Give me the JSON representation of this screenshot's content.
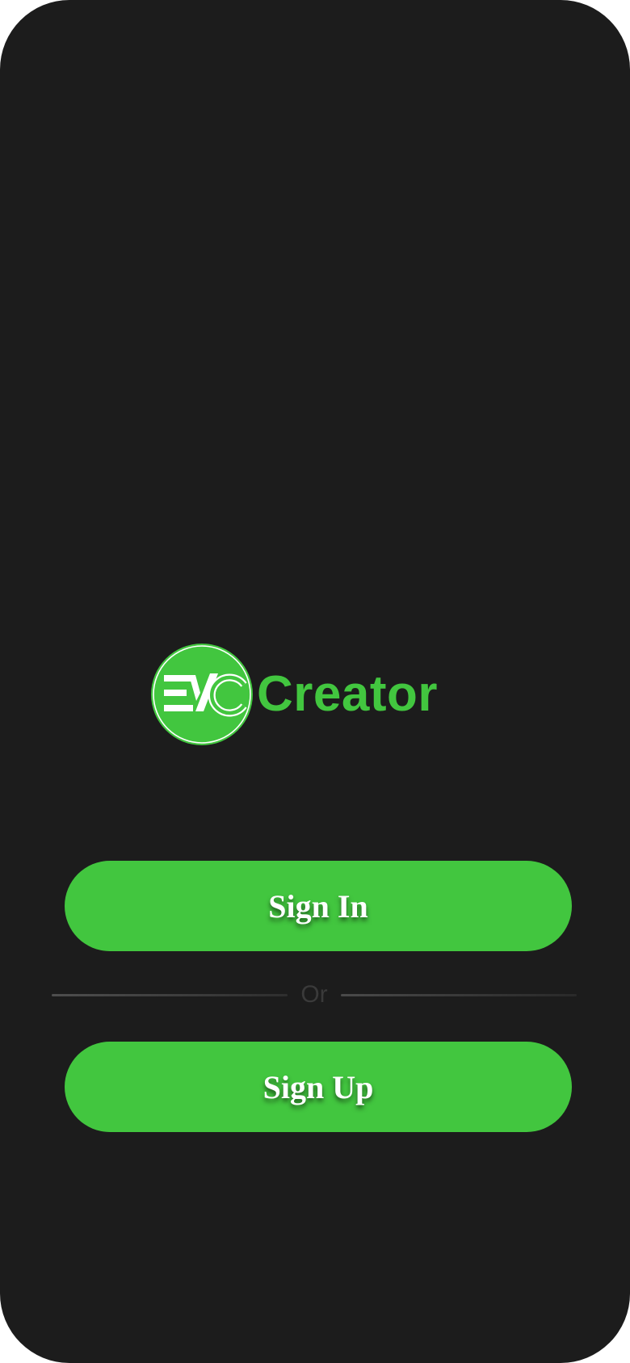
{
  "app": {
    "logo_wordmark": "Creator",
    "logo_badge_text": "EVC"
  },
  "auth": {
    "sign_in_label": "Sign In",
    "divider_label": "Or",
    "sign_up_label": "Sign Up"
  },
  "colors": {
    "background": "#1c1c1c",
    "accent": "#42c63f",
    "button_text": "#ffffff",
    "divider_text": "#3a3a3a"
  },
  "icons": {
    "logo": "evc-logo-icon"
  }
}
